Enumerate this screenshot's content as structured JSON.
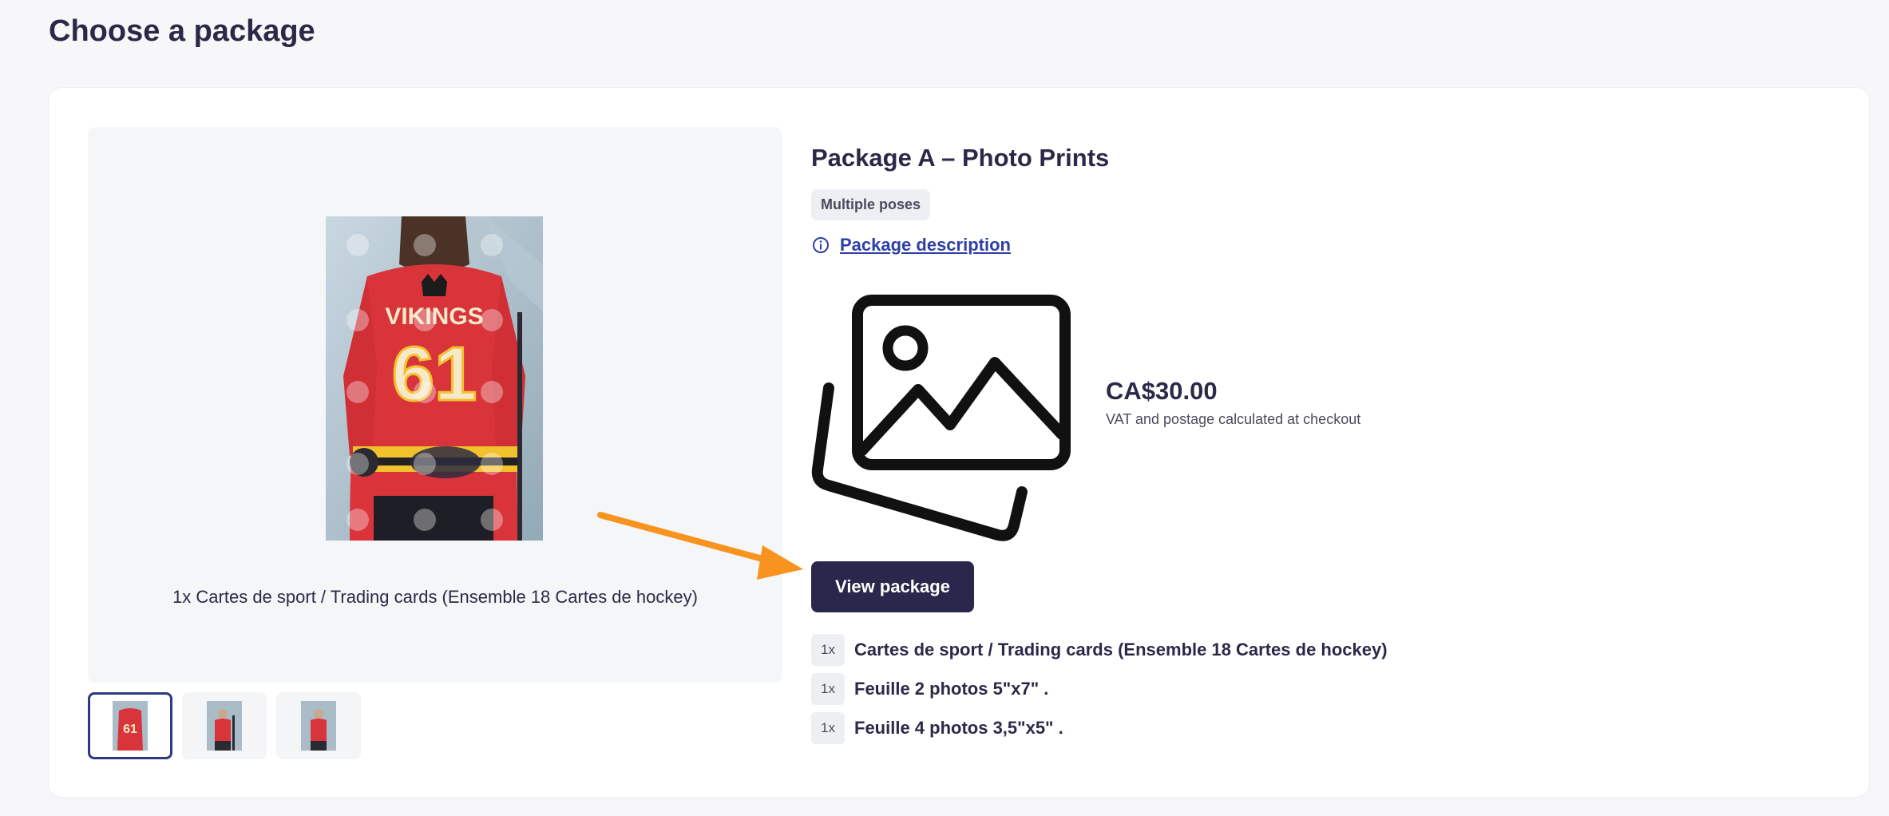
{
  "page": {
    "title": "Choose a package"
  },
  "package": {
    "name": "Package A – Photo Prints",
    "badge": "Multiple poses",
    "description_link": "Package description",
    "price": "CA$30.00",
    "price_note": "VAT and postage calculated at checkout",
    "view_button": "View package",
    "items": [
      {
        "qty": "1x",
        "label": "Cartes de sport / Trading cards (Ensemble 18 Cartes de hockey)"
      },
      {
        "qty": "1x",
        "label": "Feuille 2 photos 5\"x7\" ."
      },
      {
        "qty": "1x",
        "label": "Feuille 4 photos 3,5\"x5\" ."
      }
    ]
  },
  "preview": {
    "caption": "1x Cartes de sport / Trading cards (Ensemble 18 Cartes de hockey)",
    "jersey_text": "VIKINGS",
    "jersey_number": "61",
    "thumbnails": [
      {
        "name": "thumbnail-1",
        "active": true
      },
      {
        "name": "thumbnail-2",
        "active": false
      },
      {
        "name": "thumbnail-3",
        "active": false
      }
    ]
  },
  "colors": {
    "accent": "#29284c",
    "link": "#2e3fa8",
    "arrow": "#f7931e",
    "jersey": "#d9343a"
  },
  "icons": [
    "info-icon",
    "image-placeholder-icon",
    "annotation-arrow"
  ]
}
